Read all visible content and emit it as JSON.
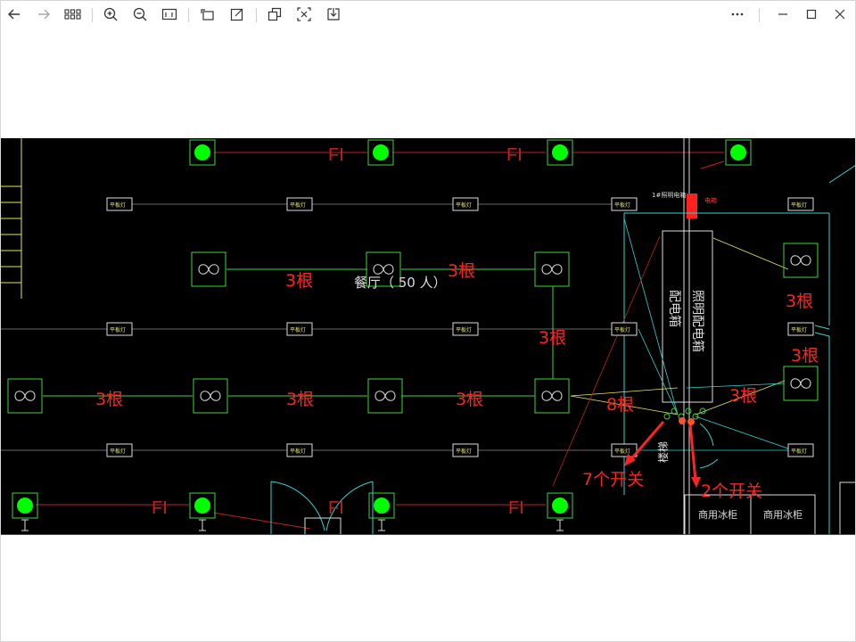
{
  "toolbar": {
    "buttons": [
      {
        "name": "back-button",
        "icon": "arrow-left-icon"
      },
      {
        "name": "forward-button",
        "icon": "arrow-right-icon"
      },
      {
        "name": "grid-view-button",
        "icon": "grid-icon"
      },
      {
        "name": "zoom-in-button",
        "icon": "zoom-in-icon"
      },
      {
        "name": "zoom-out-button",
        "icon": "zoom-out-icon"
      },
      {
        "name": "actual-size-button",
        "icon": "actual-size-icon"
      },
      {
        "name": "rotate-button",
        "icon": "rotate-icon"
      },
      {
        "name": "edit-button",
        "icon": "edit-icon"
      },
      {
        "name": "copy-button",
        "icon": "copy-icon"
      },
      {
        "name": "crop-button",
        "icon": "crop-icon"
      },
      {
        "name": "save-button",
        "icon": "download-icon"
      },
      {
        "name": "more-button",
        "icon": "more-icon"
      }
    ],
    "window_controls": [
      "minimize-icon",
      "maximize-icon",
      "close-icon"
    ]
  },
  "drawing": {
    "room_label": "餐厅（ 50 人）",
    "fixture_label": "平板灯",
    "fixture_label_short": "双管灯",
    "panel_label": "配电箱",
    "panel_side_label": "照明配电箱",
    "wire_tag": "FI",
    "stair_label": "楼梯",
    "bottom_label_1": "商用冰柜",
    "bottom_label_2": "商用冰柜",
    "small_label_top": "1#照明电箱",
    "small_label_right": "电箱",
    "annotations": {
      "a1": "3根",
      "a2": "3根",
      "a3": "3根",
      "a4": "3根",
      "a5": "3根",
      "a6": "3根",
      "a7": "3根",
      "a8": "3根",
      "a9": "3根",
      "a10": "8根",
      "switch7": "7个开关",
      "switch2": "2个开关"
    }
  },
  "colors": {
    "annotation": "#ff2222",
    "green_fixture": "#00ff00",
    "cad_green": "#3cd43c",
    "cad_cyan": "#2ed3d3",
    "cad_yellow": "#e8e85c",
    "cad_red": "#ff3030",
    "background": "#000000"
  }
}
